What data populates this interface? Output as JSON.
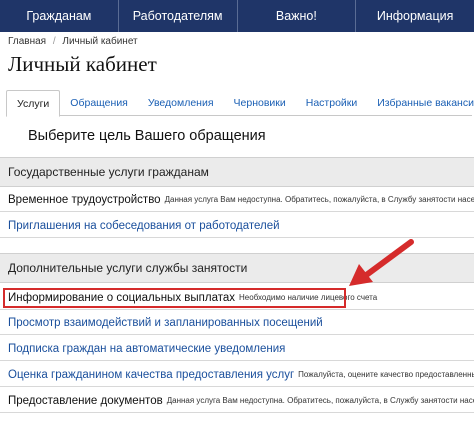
{
  "topnav": {
    "items": [
      {
        "label": "Гражданам"
      },
      {
        "label": "Работодателям"
      },
      {
        "label": "Важно!"
      },
      {
        "label": "Информация"
      }
    ]
  },
  "breadcrumb": {
    "items": [
      "Главная",
      "Личный кабинет"
    ],
    "separator": "/"
  },
  "page_title": "Личный кабинет",
  "tabs": [
    {
      "label": "Услуги",
      "active": true
    },
    {
      "label": "Обращения"
    },
    {
      "label": "Уведомления"
    },
    {
      "label": "Черновики"
    },
    {
      "label": "Настройки"
    },
    {
      "label": "Избранные вакансии"
    }
  ],
  "prompt_heading": "Выберите цель Вашего обращения",
  "sections": [
    {
      "title": "Государственные услуги гражданам",
      "rows": [
        {
          "title": "Временное трудоустройство",
          "note": "Данная услуга Вам недоступна. Обратитесь, пожалуйста, в Службу занятости населения."
        },
        {
          "title": "Приглашения на собеседования от работодателей",
          "note": ""
        }
      ]
    },
    {
      "title": "Дополнительные услуги службы занятости",
      "rows": [
        {
          "title": "Информирование о социальных выплатах",
          "note": "Необходимо наличие лицевого счета"
        },
        {
          "title": "Просмотр взаимодействий и запланированных посещений",
          "note": ""
        },
        {
          "title": "Подписка граждан на автоматические уведомления",
          "note": ""
        },
        {
          "title": "Оценка гражданином качества предоставления услуг",
          "note": "Пожалуйста, оцените качество предоставленных услуг"
        },
        {
          "title": "Предоставление документов",
          "note": "Данная услуга Вам недоступна. Обратитесь, пожалуйста, в Службу занятости населения."
        }
      ]
    }
  ],
  "colors": {
    "nav_bg": "#1f3568",
    "link": "#1a4f9c",
    "highlight": "#d52b2b"
  }
}
